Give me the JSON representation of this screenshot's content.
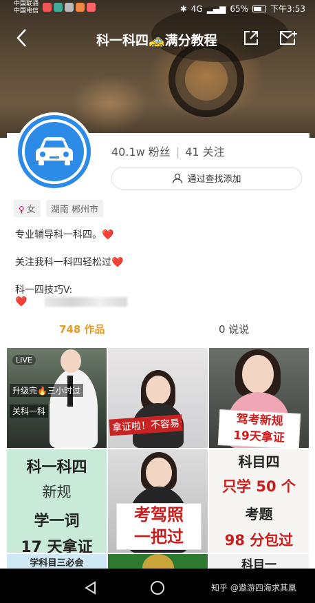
{
  "status_bar": {
    "carrier_1": "中国联通",
    "carrier_2": "中国电信",
    "network": "4G",
    "battery": "65%",
    "time": "下午3:53"
  },
  "nav": {
    "title": "科一科四🚕满分教程"
  },
  "profile": {
    "followers": "40.1w 粉丝",
    "following": "41 关注",
    "add_button": "通过查找添加",
    "gender": "女",
    "region": "湖南 郴州市",
    "bio": [
      "专业辅导科一科四。❤️",
      "关注我科一科四轻松过❤️",
      "科一四技巧V:",
      "❤️"
    ],
    "works_count": "748 作品",
    "posts_count": "0 说说"
  },
  "videos": [
    {
      "live": "LIVE",
      "captions": [
        "升级完🔥三小时过",
        "关科一科"
      ]
    },
    {
      "banner": "拿证啦！不容易"
    },
    {
      "sign": [
        "驾考新规",
        "19天拿证"
      ]
    },
    {
      "lines": [
        "科一科四",
        "新规",
        "学一词",
        "17 天拿证"
      ]
    },
    {
      "sign": [
        "考驾照",
        "一把过"
      ]
    },
    {
      "lines": [
        "科目四",
        "只学 50 个",
        "考题",
        "98 分包过"
      ]
    },
    {
      "lines": [
        "学科目三必会"
      ]
    },
    {
      "lines": [
        ""
      ]
    },
    {
      "lines": [
        "科目一"
      ]
    }
  ],
  "watermark": "知乎 @遨游四海求其凰",
  "colors": {
    "accent_orange": "#e89a28",
    "avatar_blue": "#2d8be8",
    "heart_red": "#d81e2b"
  }
}
